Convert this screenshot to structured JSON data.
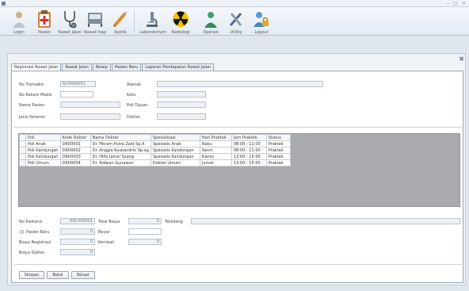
{
  "window": {
    "buttons": [
      "‒",
      "□",
      "✕"
    ]
  },
  "ribbon": [
    {
      "label": "Login",
      "icon": "person-icon"
    },
    {
      "label": "Pasien",
      "icon": "clipboard-plus-icon"
    },
    {
      "label": "Rawat Jalan",
      "icon": "stethoscope-icon"
    },
    {
      "label": "Rawat Inap",
      "icon": "bed-icon"
    },
    {
      "label": "Apotik",
      "icon": "syringe-icon"
    },
    {
      "label": "Laboratorium",
      "icon": "microscope-icon"
    },
    {
      "label": "Radiologi",
      "icon": "radiation-icon"
    },
    {
      "label": "Operasi",
      "icon": "doctor-icon"
    },
    {
      "label": "Utility",
      "icon": "tools-icon"
    },
    {
      "label": "Logout",
      "icon": "user-lock-icon"
    }
  ],
  "tabs": [
    "Registrasi Rawat Jalan",
    "Rawat Jalan",
    "Resep",
    "Pasien Baru",
    "Laporan Pendapatan Rawat Jalan"
  ],
  "form": {
    "no_transaksi_label": "No Transaksi",
    "no_transaksi_value": "RJ-0000001",
    "no_rekam_medis_label": "No Rekam Medis",
    "nama_pasien_label": "Nama Pasien",
    "jenis_kelamin_label": "Jenis Kelamin",
    "alamat_label": "Alamat",
    "kota_label": "Kota",
    "poli_tujuan_label": "Poli Tujuan",
    "dokter_label": "Dokter"
  },
  "table": {
    "columns": [
      "Poli",
      "Kode Dokter",
      "Nama Dokter",
      "Spesialisasi",
      "Hari Praktek",
      "Jam Praktek",
      "Status"
    ],
    "rows": [
      [
        "Poli Anak",
        "DR00001",
        "Dr. Fikram Putra Zaid Sp.A",
        "Spesialis Anak",
        "Rabu",
        "08:00 - 11:00",
        "Praktek"
      ],
      [
        "Poli Kandungan",
        "DR00002",
        "Dr. Anggia Kusbandrio Sp.og",
        "Spesialis Kandungan",
        "Senin",
        "08:00 - 11:00",
        "Praktek"
      ],
      [
        "Poli Kandungan",
        "DR00003",
        "Dr. Hilfy Jamal Syang",
        "Spesialis Kandungan",
        "Kamis",
        "13:00 - 15:00",
        "Praktek"
      ],
      [
        "Poli Umum",
        "DR00004",
        "Dr. Ridwan Gunawan",
        "Dokter Umum",
        "Jumat",
        "13:00 - 15:00",
        "Praktek"
      ]
    ]
  },
  "payment": {
    "no_kwitansi_label": "No Kwitansi",
    "no_kwitansi_value": "KW-000001",
    "pasien_baru_label": "Pasien Baru",
    "pasien_baru_value": "0",
    "biaya_registrasi_label": "Biaya Registrasi",
    "biaya_registrasi_value": "0",
    "biaya_dokter_label": "Biaya Dokter",
    "biaya_dokter_value": "0",
    "total_biaya_label": "Total Biaya",
    "total_biaya_value": "0",
    "bayar_label": "Bayar",
    "kembali_label": "Kembali",
    "kembali_value": "0",
    "terbilang_label": "Terbilang"
  },
  "buttons": {
    "simpan": "Simpan",
    "batal": "Batal",
    "keluar": "Keluar"
  }
}
